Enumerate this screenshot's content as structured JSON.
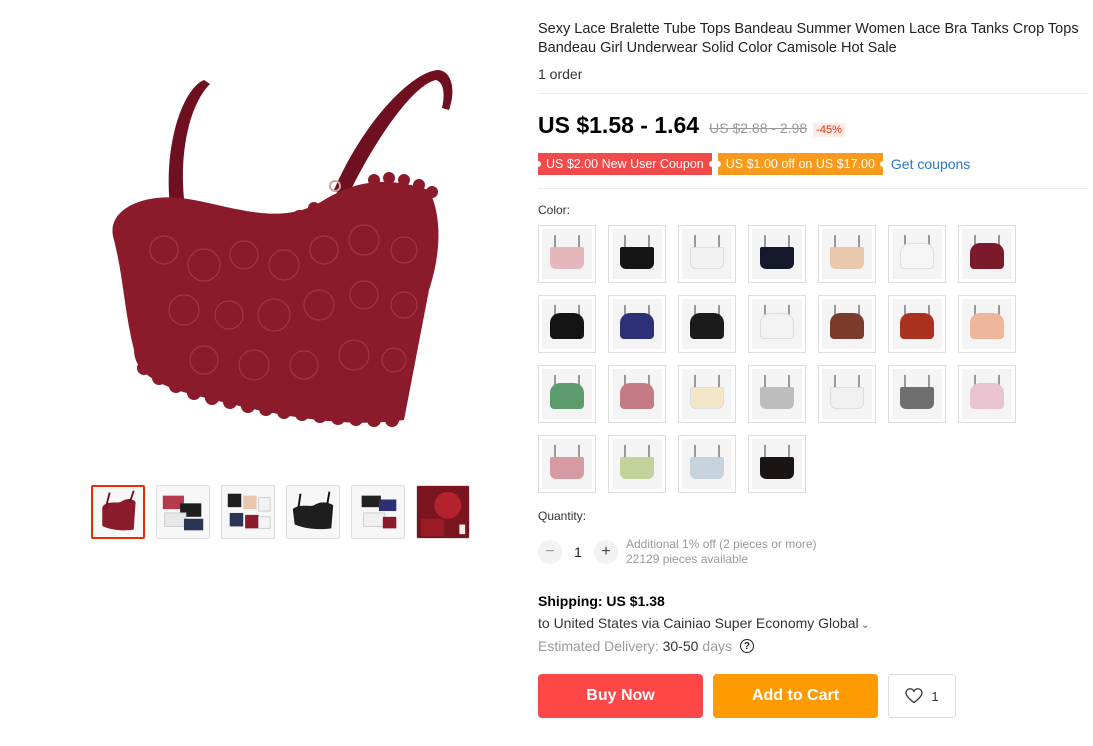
{
  "product": {
    "title": "Sexy Lace Bralette Tube Tops Bandeau Summer Women Lace Bra Tanks Crop Tops Bandeau Girl Underwear Solid Color Camisole Hot Sale",
    "orders": "1 order",
    "price": "US $1.58 - 1.64",
    "old_price": "US $2.88 - 2.98",
    "discount": "-45%",
    "main_image_color": "#8b1a2b"
  },
  "coupons": {
    "new_user": "US $2.00 New User Coupon",
    "store": "US $1.00 off on US $17.00",
    "get_link": "Get coupons"
  },
  "gallery": {
    "thumbs": [
      {
        "name": "thumb-1",
        "color": "#8b1a2b"
      },
      {
        "name": "thumb-2",
        "color": "#b73a4a"
      },
      {
        "name": "thumb-3",
        "color": "#2a3556"
      },
      {
        "name": "thumb-4",
        "color": "#1e1e1e"
      },
      {
        "name": "thumb-5",
        "color": "#222222"
      },
      {
        "name": "thumb-6",
        "color": "#9a1b26"
      }
    ]
  },
  "color": {
    "label": "Color:",
    "options": [
      {
        "color": "#e4b7bd",
        "style": "tube"
      },
      {
        "color": "#151515",
        "style": "tube"
      },
      {
        "color": "#f2f2f2",
        "style": "tube"
      },
      {
        "color": "#15182a",
        "style": "tube"
      },
      {
        "color": "#e9c7ad",
        "style": "tube"
      },
      {
        "color": "#f5f5f5",
        "style": "bralette"
      },
      {
        "color": "#7b1a2a",
        "style": "bralette"
      },
      {
        "color": "#141414",
        "style": "bralette"
      },
      {
        "color": "#2c3177",
        "style": "bralette"
      },
      {
        "color": "#1b1b1b",
        "style": "bralette"
      },
      {
        "color": "#f3f3f3",
        "style": "bralette"
      },
      {
        "color": "#7a3b2c",
        "style": "bralette"
      },
      {
        "color": "#a8321f",
        "style": "bralette"
      },
      {
        "color": "#eeb79c",
        "style": "bralette"
      },
      {
        "color": "#5c9b6c",
        "style": "bralette"
      },
      {
        "color": "#c57b84",
        "style": "bralette"
      },
      {
        "color": "#f3e6c9",
        "style": "tube"
      },
      {
        "color": "#bdbdbd",
        "style": "tube"
      },
      {
        "color": "#f0f0f0",
        "style": "tube"
      },
      {
        "color": "#6e6e6e",
        "style": "tube"
      },
      {
        "color": "#e9c3cf",
        "style": "bralette"
      },
      {
        "color": "#d69aa5",
        "style": "tube"
      },
      {
        "color": "#c1d29a",
        "style": "tube"
      },
      {
        "color": "#c7d3dc",
        "style": "tube"
      },
      {
        "color": "#1a1414",
        "style": "tube"
      }
    ]
  },
  "quantity": {
    "label": "Quantity:",
    "value": "1",
    "minus": "−",
    "plus": "+",
    "note_discount": "Additional 1% off (2 pieces or more)",
    "note_stock": "22129 pieces available"
  },
  "shipping": {
    "title": "Shipping: US $1.38",
    "to": "to United States via Cainiao Super Economy Global",
    "chevron": "⌄",
    "delivery_label": "Estimated Delivery:",
    "delivery_value": "30-50",
    "delivery_unit": "days",
    "help_icon": "?"
  },
  "actions": {
    "buy_now": "Buy Now",
    "add_to_cart": "Add to Cart",
    "wishlist_count": "1"
  }
}
